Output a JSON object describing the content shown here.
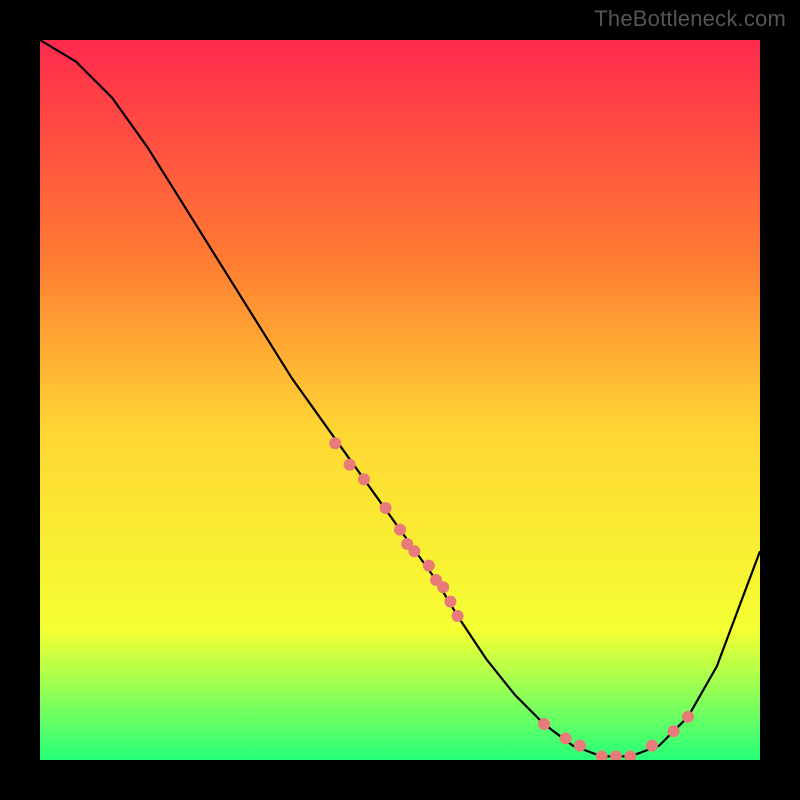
{
  "watermark": "TheBottleneck.com",
  "chart_data": {
    "type": "line",
    "title": "",
    "xlabel": "",
    "ylabel": "",
    "xlim": [
      0,
      100
    ],
    "ylim": [
      0,
      100
    ],
    "gradient_colors": {
      "top": "#ff2a4d",
      "mid_upper": "#ff7a33",
      "mid": "#ffd833",
      "mid_lower": "#f4ff33",
      "bottom": "#26ff7a"
    },
    "series": [
      {
        "name": "curve",
        "color": "#000000",
        "x": [
          0,
          5,
          10,
          15,
          20,
          25,
          30,
          35,
          40,
          45,
          50,
          55,
          58,
          62,
          66,
          70,
          74,
          78,
          82,
          86,
          90,
          94,
          97,
          100
        ],
        "y": [
          100,
          97,
          92,
          85,
          77,
          69,
          61,
          53,
          46,
          39,
          32,
          25,
          20,
          14,
          9,
          5,
          2,
          0.5,
          0.5,
          2,
          6,
          13,
          21,
          29
        ]
      },
      {
        "name": "highlight-dots",
        "color": "#e87a7a",
        "x": [
          41,
          43,
          45,
          48,
          50,
          51,
          52,
          54,
          55,
          56,
          57,
          58,
          70,
          73,
          75,
          78,
          80,
          82,
          85,
          88,
          90
        ],
        "y": [
          44,
          41,
          39,
          35,
          32,
          30,
          29,
          27,
          25,
          24,
          22,
          20,
          5,
          3,
          2,
          0.5,
          0.5,
          0.5,
          2,
          4,
          6
        ]
      }
    ]
  }
}
